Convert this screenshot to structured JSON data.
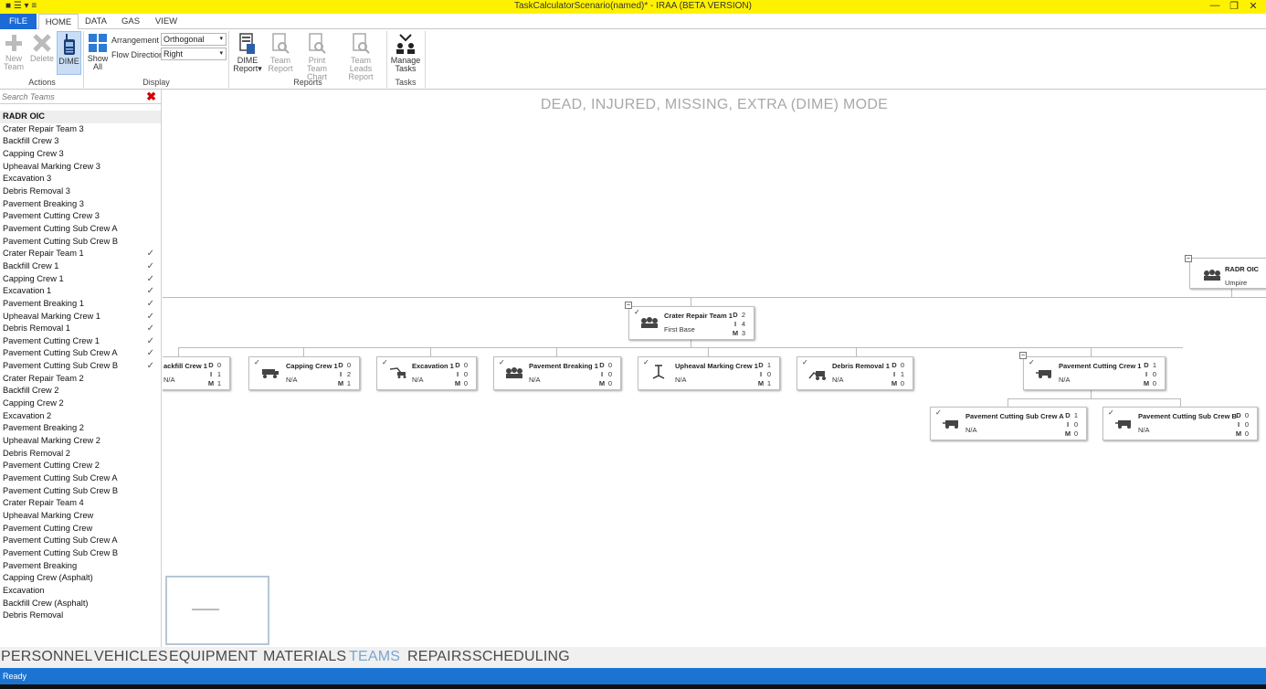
{
  "window": {
    "title": "TaskCalculatorScenario(named)* - IRAA (BETA VERSION)",
    "qa_symbols": "■  ☰ ▾  ≡",
    "minimize": "—",
    "restore": "❐",
    "close": "✕"
  },
  "tabs": {
    "file": "FILE",
    "home": "HOME",
    "data": "DATA",
    "gas": "GAS",
    "view": "VIEW"
  },
  "ribbon": {
    "actions": {
      "new_team": "New Team",
      "delete": "Delete",
      "dime": "DIME",
      "group": "Actions"
    },
    "display": {
      "show_all": "Show All",
      "arrangement_label": "Arrangement",
      "arrangement_value": "Orthogonal",
      "flow_label": "Flow Direction",
      "flow_value": "Right",
      "group": "Display"
    },
    "reports": {
      "dime_report": "DIME Report",
      "team_report": "Team Report",
      "print_team_chart": "Print Team Chart",
      "team_leads_report": "Team Leads Report",
      "group": "Reports"
    },
    "tasks": {
      "manage_tasks": "Manage Tasks",
      "group": "Tasks"
    }
  },
  "sidebar": {
    "search_placeholder": "Search Teams",
    "clear_symbol": "✖",
    "check_symbol": "✓",
    "teams": [
      {
        "name": "RADR OIC",
        "checked": false
      },
      {
        "name": "Crater Repair Team 3",
        "checked": false
      },
      {
        "name": "Backfill Crew 3",
        "checked": false
      },
      {
        "name": "Capping Crew 3",
        "checked": false
      },
      {
        "name": "Upheaval Marking Crew 3",
        "checked": false
      },
      {
        "name": "Excavation 3",
        "checked": false
      },
      {
        "name": "Debris Removal 3",
        "checked": false
      },
      {
        "name": "Pavement Breaking 3",
        "checked": false
      },
      {
        "name": "Pavement Cutting Crew 3",
        "checked": false
      },
      {
        "name": "Pavement Cutting Sub Crew A",
        "checked": false
      },
      {
        "name": "Pavement Cutting Sub Crew B",
        "checked": false
      },
      {
        "name": "Crater Repair Team 1",
        "checked": true
      },
      {
        "name": "Backfill Crew 1",
        "checked": true
      },
      {
        "name": "Capping Crew 1",
        "checked": true
      },
      {
        "name": "Excavation 1",
        "checked": true
      },
      {
        "name": "Pavement Breaking 1",
        "checked": true
      },
      {
        "name": "Upheaval Marking Crew 1",
        "checked": true
      },
      {
        "name": "Debris Removal 1",
        "checked": true
      },
      {
        "name": "Pavement Cutting Crew 1",
        "checked": true
      },
      {
        "name": "Pavement Cutting Sub Crew A",
        "checked": true
      },
      {
        "name": "Pavement Cutting Sub Crew B",
        "checked": true
      },
      {
        "name": "Crater Repair Team 2",
        "checked": false
      },
      {
        "name": "Backfill Crew 2",
        "checked": false
      },
      {
        "name": "Capping Crew 2",
        "checked": false
      },
      {
        "name": "Excavation 2",
        "checked": false
      },
      {
        "name": "Pavement Breaking 2",
        "checked": false
      },
      {
        "name": "Upheaval Marking Crew 2",
        "checked": false
      },
      {
        "name": "Debris Removal 2",
        "checked": false
      },
      {
        "name": "Pavement Cutting Crew 2",
        "checked": false
      },
      {
        "name": "Pavement Cutting Sub Crew A",
        "checked": false
      },
      {
        "name": "Pavement Cutting Sub Crew B",
        "checked": false
      },
      {
        "name": "Crater Repair Team 4",
        "checked": false
      },
      {
        "name": "Upheaval Marking Crew",
        "checked": false
      },
      {
        "name": "Pavement Cutting Crew",
        "checked": false
      },
      {
        "name": "Pavement Cutting Sub Crew A",
        "checked": false
      },
      {
        "name": "Pavement Cutting Sub Crew B",
        "checked": false
      },
      {
        "name": "Pavement Breaking",
        "checked": false
      },
      {
        "name": "Capping Crew (Asphalt)",
        "checked": false
      },
      {
        "name": "Excavation",
        "checked": false
      },
      {
        "name": "Backfill Crew (Asphalt)",
        "checked": false
      },
      {
        "name": "Debris Removal",
        "checked": false
      }
    ]
  },
  "canvas": {
    "mode_title": "DEAD, INJURED, MISSING, EXTRA (DIME) MODE",
    "collapse_symbol": "−",
    "dime_letters": {
      "d": "D",
      "i": "I",
      "m": "M"
    },
    "nodes": {
      "radr": {
        "name": "RADR OIC",
        "sub": "Umpire"
      },
      "crater1": {
        "name": "Crater Repair Team 1",
        "sub": "First Base",
        "d": "2",
        "i": "4",
        "m": "3"
      },
      "backfill1": {
        "name": "ackfill Crew 1",
        "sub": "N/A",
        "d": "0",
        "i": "1",
        "m": "1"
      },
      "capping1": {
        "name": "Capping Crew 1",
        "sub": "N/A",
        "d": "0",
        "i": "2",
        "m": "1"
      },
      "excavation1": {
        "name": "Excavation 1",
        "sub": "N/A",
        "d": "0",
        "i": "0",
        "m": "0"
      },
      "pavebreak1": {
        "name": "Pavement Breaking 1",
        "sub": "N/A",
        "d": "0",
        "i": "0",
        "m": "0"
      },
      "upheaval1": {
        "name": "Upheaval Marking Crew 1",
        "sub": "N/A",
        "d": "1",
        "i": "0",
        "m": "1"
      },
      "debris1": {
        "name": "Debris Removal 1",
        "sub": "N/A",
        "d": "0",
        "i": "1",
        "m": "0"
      },
      "pavecut1": {
        "name": "Pavement Cutting Crew 1",
        "sub": "N/A",
        "d": "1",
        "i": "0",
        "m": "0"
      },
      "subA": {
        "name": "Pavement Cutting Sub Crew A",
        "sub": "N/A",
        "d": "1",
        "i": "0",
        "m": "0"
      },
      "subB": {
        "name": "Pavement Cutting Sub Crew B",
        "sub": "N/A",
        "d": "0",
        "i": "0",
        "m": "0"
      }
    },
    "check_symbol": "✓"
  },
  "bottom_nav": {
    "personnel": "PERSONNEL",
    "vehicles": "VEHICLES",
    "equipment": "EQUIPMENT",
    "materials": "MATERIALS",
    "teams": "TEAMS",
    "repairs": "REPAIRS",
    "scheduling": "SCHEDULING"
  },
  "status": {
    "text": "Ready"
  },
  "colors": {
    "title_bar": "#fff200",
    "accent_blue": "#1b6ad6",
    "status_blue": "#1b74d2",
    "active_nav": "#79a6d2"
  }
}
